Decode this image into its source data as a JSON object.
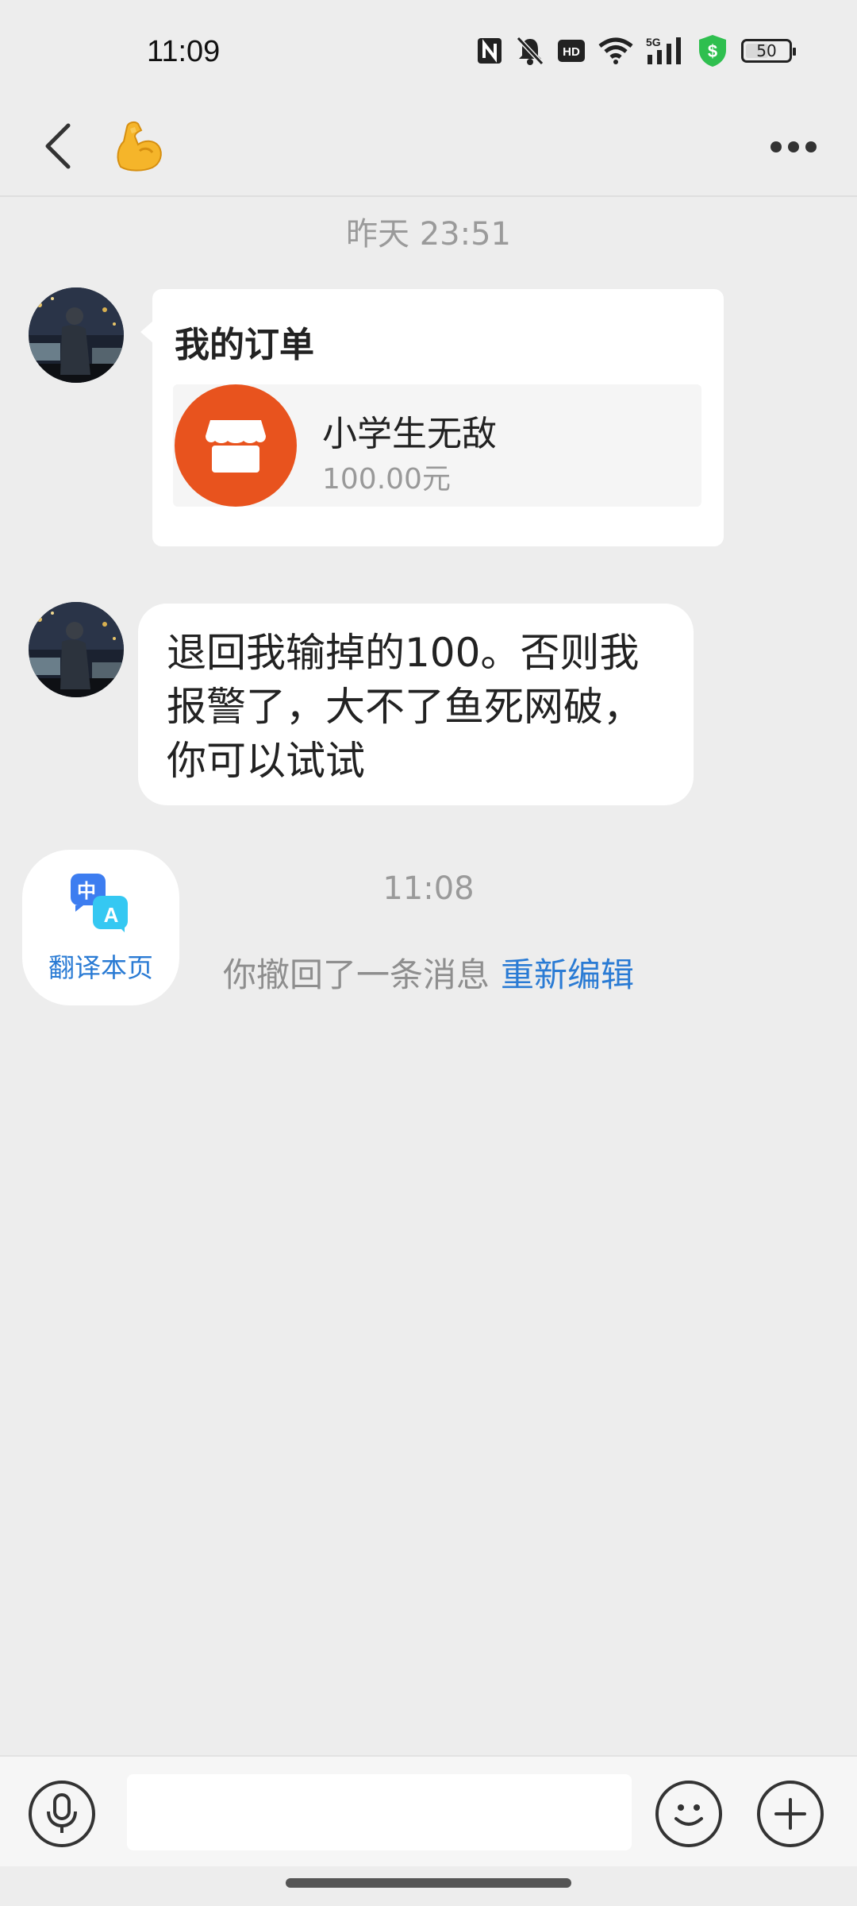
{
  "status_bar": {
    "time": "11:09",
    "network": "5G",
    "hd": "HD",
    "battery": "50",
    "icons": [
      "nfc-icon",
      "mute-bell-icon",
      "hd-icon",
      "wifi-icon",
      "5g-signal-icon",
      "shield-dollar-icon",
      "battery-icon"
    ]
  },
  "header": {
    "title_emoji": "💪",
    "icons": [
      "back-arrow-icon",
      "more-dots-icon"
    ]
  },
  "chat": {
    "timestamp_1": "昨天 23:51",
    "order_card": {
      "title": "我的订单",
      "item_name": "小学生无敌",
      "item_price": "100.00元",
      "icon": "shop-icon"
    },
    "message_lines": [
      "退回我输掉的100。否则我",
      "报警了，大不了鱼死网破，",
      "你可以试试"
    ],
    "timestamp_2": "11:08",
    "recall_text": "你撤回了一条消息",
    "recall_action": "重新编辑"
  },
  "translate_widget": {
    "label": "翻译本页",
    "glyph_zh": "中",
    "glyph_a": "A"
  },
  "input_bar": {
    "placeholder": "",
    "icons": [
      "microphone-icon",
      "emoji-face-icon",
      "plus-icon"
    ]
  },
  "colors": {
    "background": "#ededed",
    "accent_blue": "#2a7bd4",
    "shop_orange": "#e8531e",
    "bubble_white": "#ffffff"
  }
}
